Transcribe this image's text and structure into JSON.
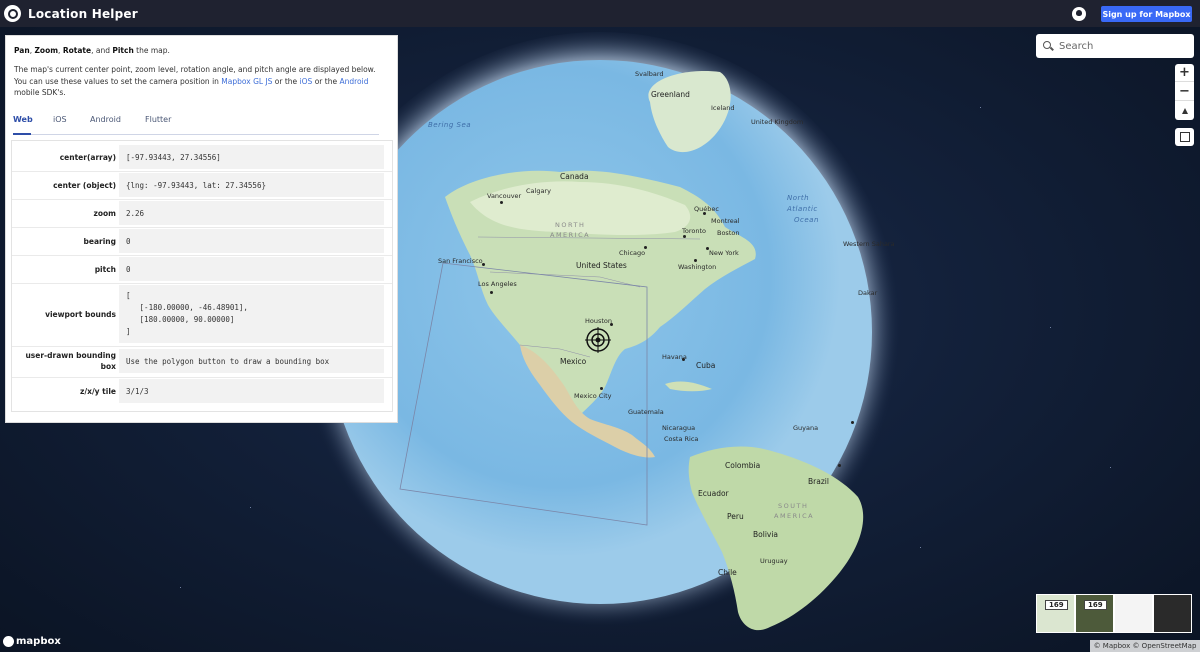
{
  "app": {
    "title": "Location Helper"
  },
  "header": {
    "signup_label": "Sign up for Mapbox"
  },
  "panel": {
    "intro": {
      "pan": "Pan",
      "zoom": "Zoom",
      "rotate": "Rotate",
      "pitch": "Pitch",
      "sep1": ", ",
      "sep2": ", ",
      "sep3": ", and ",
      "rest": " the map."
    },
    "desc": {
      "part1": "The map's current center point, zoom level, rotation angle, and pitch angle are displayed below. You can use these values to set the camera position in ",
      "link_gl": "Mapbox GL JS",
      "part2": " or the ",
      "link_ios": "iOS",
      "part3": " or the ",
      "link_android": "Android",
      "part4": " mobile SDK's."
    },
    "tabs": [
      {
        "label": "Web"
      },
      {
        "label": "iOS"
      },
      {
        "label": "Android"
      },
      {
        "label": "Flutter"
      }
    ],
    "rows": [
      {
        "label": "center(array)",
        "value": "[-97.93443, 27.34556]"
      },
      {
        "label": "center (object)",
        "value": "{lng: -97.93443, lat: 27.34556}"
      },
      {
        "label": "zoom",
        "value": "2.26"
      },
      {
        "label": "bearing",
        "value": "0"
      },
      {
        "label": "pitch",
        "value": "0"
      },
      {
        "label": "viewport bounds",
        "value": "[\n   [-180.00000, -46.48901],\n   [180.00000, 90.00000]\n]"
      },
      {
        "label": "user-drawn bounding box",
        "value": "Use the polygon button to draw a bounding box"
      },
      {
        "label": "z/x/y tile",
        "value": "3/1/3"
      }
    ]
  },
  "search": {
    "placeholder": "Search"
  },
  "controls": {
    "zoom_in": "+",
    "zoom_out": "−"
  },
  "style_switcher": {
    "badge": "169"
  },
  "footer": {
    "logo": "mapbox",
    "attribution": "© Mapbox © OpenStreetMap"
  },
  "map_labels": {
    "svalbard": "Svalbard",
    "greenland": "Greenland",
    "iceland": "Iceland",
    "uk": "United Kingdom",
    "bering": "Bering Sea",
    "canada": "Canada",
    "calgary": "Calgary",
    "vancouver": "Vancouver",
    "north": "NORTH",
    "america": "AMERICA",
    "quebec": "Québec",
    "montreal": "Montreal",
    "toronto": "Toronto",
    "boston": "Boston",
    "chicago": "Chicago",
    "newyork": "New York",
    "washington": "Washington",
    "north_ocean": "North",
    "atlantic_ocean": "Atlantic",
    "ocean_word": "Ocean",
    "wsahara": "Western Sahara",
    "sanfrancisco": "San Francisco",
    "us": "United States",
    "losangeles": "Los Angeles",
    "houston": "Houston",
    "dakar": "Dakar",
    "mexico": "Mexico",
    "havana": "Havana",
    "cuba": "Cuba",
    "mexicocity": "Mexico City",
    "guatemala": "Guatemala",
    "nicaragua": "Nicaragua",
    "costarica": "Costa Rica",
    "guyana": "Guyana",
    "colombia": "Colombia",
    "ecuador": "Ecuador",
    "brazil": "Brazil",
    "south": "SOUTH",
    "america2": "AMERICA",
    "peru": "Peru",
    "bolivia": "Bolivia",
    "chile": "Chile",
    "uruguay": "Uruguay"
  }
}
